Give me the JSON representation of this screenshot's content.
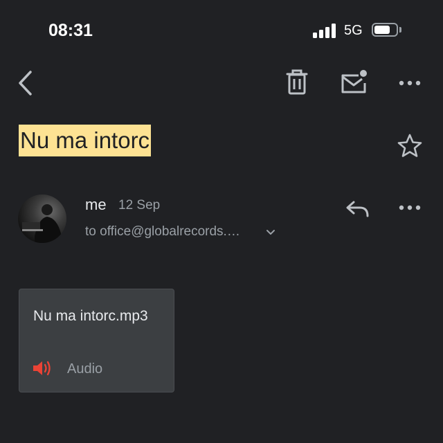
{
  "status_bar": {
    "time": "08:31",
    "network": "5G",
    "battery_level": 0.72
  },
  "toolbar": {
    "icons": [
      "back-icon",
      "delete-icon",
      "mark-unread-icon",
      "more-icon"
    ]
  },
  "email": {
    "subject": "Nu ma intorc",
    "sender": "me",
    "date": "12 Sep",
    "recipient": "to office@globalrecords.…",
    "attachment": {
      "filename": "Nu ma intorc.mp3",
      "type": "Audio"
    }
  },
  "colors": {
    "background": "#202124",
    "subject_highlight": "#fde293",
    "audio_icon": "#ea4335",
    "text_primary": "#e8eaed",
    "text_secondary": "#9aa0a6"
  }
}
